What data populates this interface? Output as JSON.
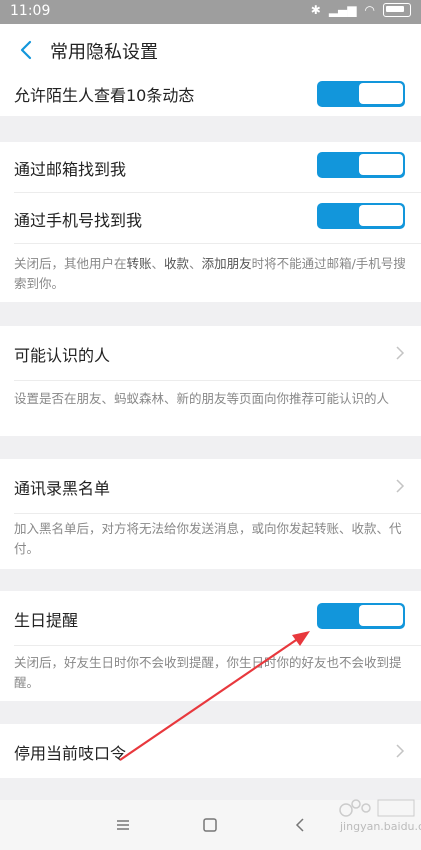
{
  "status_bar": {
    "time": "11:09"
  },
  "header": {
    "title": "常用隐私设置"
  },
  "rows": {
    "stranger_posts": {
      "label": "允许陌生人查看10条动态",
      "enabled": true
    },
    "find_by_email": {
      "label": "通过邮箱找到我",
      "enabled": true
    },
    "find_by_phone": {
      "label": "通过手机号找到我",
      "enabled": true
    },
    "find_desc": {
      "pre": "关闭后，其他用户在",
      "b1": "转账",
      "s1": "、",
      "b2": "收款",
      "s2": "、",
      "b3": "添加朋友",
      "post": "时将不能通过邮箱/手机号搜索到你。"
    },
    "people_you_may_know": {
      "label": "可能认识的人"
    },
    "people_desc": "设置是否在朋友、蚂蚁森林、新的朋友等页面向你推荐可能认识的人",
    "blacklist": {
      "label": "通讯录黑名单"
    },
    "blacklist_desc": "加入黑名单后，对方将无法给你发送消息，或向你发起转账、收款、代付。",
    "birthday": {
      "label": "生日提醒",
      "enabled": true
    },
    "birthday_desc": "关闭后，好友生日时你不会收到提醒，你生日时你的好友也不会收到提醒。",
    "disable_code": {
      "label": "停用当前吱口令"
    }
  },
  "colors": {
    "accent": "#1296db",
    "annotation": "#e8383d"
  },
  "watermark": {
    "text": "jingyan.baidu.com"
  }
}
